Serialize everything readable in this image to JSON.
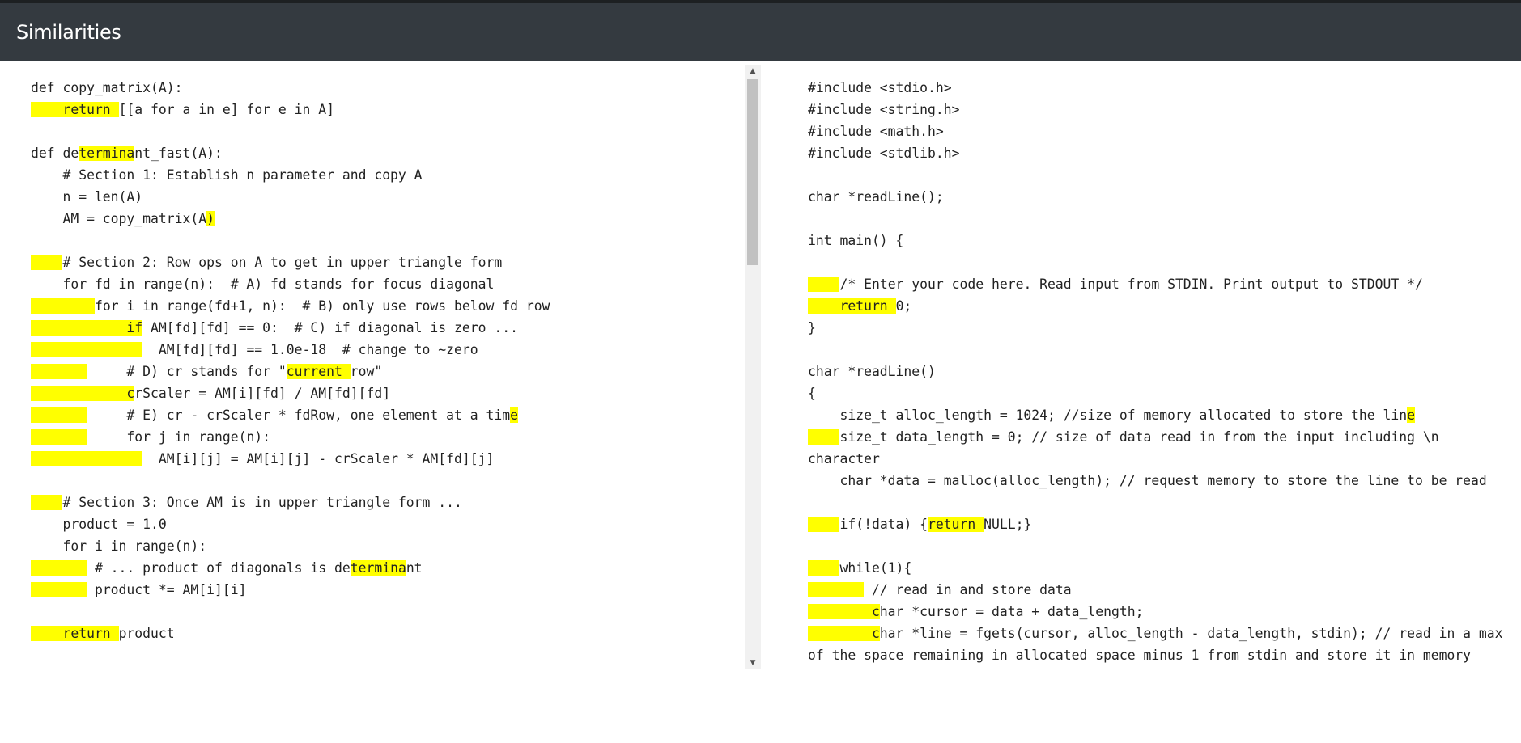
{
  "header": {
    "title": "Similarities"
  },
  "colors": {
    "header_bg": "#343a40",
    "highlight": "#ffff00",
    "scrollbar_thumb": "#c1c1c1"
  },
  "scrollbar": {
    "up_icon": "arrow-up-icon",
    "down_icon": "arrow-down-icon"
  },
  "left_code": [
    [
      {
        "t": "def copy_matrix(A):"
      }
    ],
    [
      {
        "t": "    return ",
        "h": 1
      },
      {
        "t": "[[a for a in e] for e in A]"
      }
    ],
    [
      {
        "t": ""
      }
    ],
    [
      {
        "t": "def de"
      },
      {
        "t": "termina",
        "h": 1
      },
      {
        "t": "nt_fast(A):"
      }
    ],
    [
      {
        "t": "    # Section 1: Establish n parameter and copy A"
      }
    ],
    [
      {
        "t": "    n = len(A)"
      }
    ],
    [
      {
        "t": "    AM = copy_matrix(A"
      },
      {
        "t": ")",
        "h": 1
      }
    ],
    [
      {
        "t": ""
      }
    ],
    [
      {
        "t": "    ",
        "h": 1
      },
      {
        "t": "# Section 2: Row ops on A to get in upper triangle form"
      }
    ],
    [
      {
        "t": "    for fd in range(n):  # A) fd stands for focus diagonal"
      }
    ],
    [
      {
        "t": "        ",
        "h": 1
      },
      {
        "t": "for i in range(fd+1, n):  # B) only use rows below fd row"
      }
    ],
    [
      {
        "t": "            if",
        "h": 1
      },
      {
        "t": " AM[fd][fd] == 0:  # C) if diagonal is zero ..."
      }
    ],
    [
      {
        "t": "              ",
        "h": 1
      },
      {
        "t": "  AM[fd][fd] == 1.0e-18  # change to ~zero"
      }
    ],
    [
      {
        "t": "       ",
        "h": 1
      },
      {
        "t": "     # D) cr stands for \""
      },
      {
        "t": "current ",
        "h": 1
      },
      {
        "t": "row\""
      }
    ],
    [
      {
        "t": "            c",
        "h": 1
      },
      {
        "t": "rScaler = AM[i][fd] / AM[fd][fd]"
      }
    ],
    [
      {
        "t": "       ",
        "h": 1
      },
      {
        "t": "     # E) cr - crScaler * fdRow, one element at a tim"
      },
      {
        "t": "e",
        "h": 1
      }
    ],
    [
      {
        "t": "       ",
        "h": 1
      },
      {
        "t": "     for j in range(n):"
      }
    ],
    [
      {
        "t": "              ",
        "h": 1
      },
      {
        "t": "  AM[i][j] = AM[i][j] - crScaler * AM[fd][j]"
      }
    ],
    [
      {
        "t": ""
      }
    ],
    [
      {
        "t": "    ",
        "h": 1
      },
      {
        "t": "# Section 3: Once AM is in upper triangle form ..."
      }
    ],
    [
      {
        "t": "    product = 1.0"
      }
    ],
    [
      {
        "t": "    for i in range(n):"
      }
    ],
    [
      {
        "t": "       ",
        "h": 1
      },
      {
        "t": " # ... product of diagonals is de"
      },
      {
        "t": "termina",
        "h": 1
      },
      {
        "t": "nt"
      }
    ],
    [
      {
        "t": "       ",
        "h": 1
      },
      {
        "t": " product *= AM[i][i]"
      }
    ],
    [
      {
        "t": ""
      }
    ],
    [
      {
        "t": "    return ",
        "h": 1
      },
      {
        "t": "product"
      }
    ]
  ],
  "right_code": [
    [
      {
        "t": "#include <stdio.h>"
      }
    ],
    [
      {
        "t": "#include <string.h>"
      }
    ],
    [
      {
        "t": "#include <math.h>"
      }
    ],
    [
      {
        "t": "#include <stdlib.h>"
      }
    ],
    [
      {
        "t": ""
      }
    ],
    [
      {
        "t": "char *readLine();"
      }
    ],
    [
      {
        "t": ""
      }
    ],
    [
      {
        "t": "int main() {"
      }
    ],
    [
      {
        "t": ""
      }
    ],
    [
      {
        "t": "    ",
        "h": 1
      },
      {
        "t": "/* Enter your code here. Read input from STDIN. Print output to STDOUT */"
      }
    ],
    [
      {
        "t": "    return ",
        "h": 1
      },
      {
        "t": "0;"
      }
    ],
    [
      {
        "t": "}"
      }
    ],
    [
      {
        "t": ""
      }
    ],
    [
      {
        "t": "char *readLine()"
      }
    ],
    [
      {
        "t": "{"
      }
    ],
    [
      {
        "t": "    size_t alloc_length = 1024; //size of memory allocated to store the lin"
      },
      {
        "t": "e",
        "h": 1
      }
    ],
    [
      {
        "t": "    ",
        "h": 1
      },
      {
        "t": "size_t data_length = 0; // size of data read in from the input including \\n"
      }
    ],
    [
      {
        "t": "character"
      }
    ],
    [
      {
        "t": "    char *data = malloc(alloc_length); // request memory to store the line to be read"
      }
    ],
    [
      {
        "t": ""
      }
    ],
    [
      {
        "t": "    ",
        "h": 1
      },
      {
        "t": "if(!data) {"
      },
      {
        "t": "return ",
        "h": 1
      },
      {
        "t": "NULL;}"
      }
    ],
    [
      {
        "t": ""
      }
    ],
    [
      {
        "t": "    ",
        "h": 1
      },
      {
        "t": "while(1){"
      }
    ],
    [
      {
        "t": "       ",
        "h": 1
      },
      {
        "t": " // read in and store data"
      }
    ],
    [
      {
        "t": "        c",
        "h": 1
      },
      {
        "t": "har *cursor = data + data_length;"
      }
    ],
    [
      {
        "t": "        c",
        "h": 1
      },
      {
        "t": "har *line = fgets(cursor, alloc_length - data_length, stdin); // read in a max"
      }
    ],
    [
      {
        "t": "of the space remaining in allocated space minus 1 from stdin and store it in memory"
      }
    ]
  ]
}
